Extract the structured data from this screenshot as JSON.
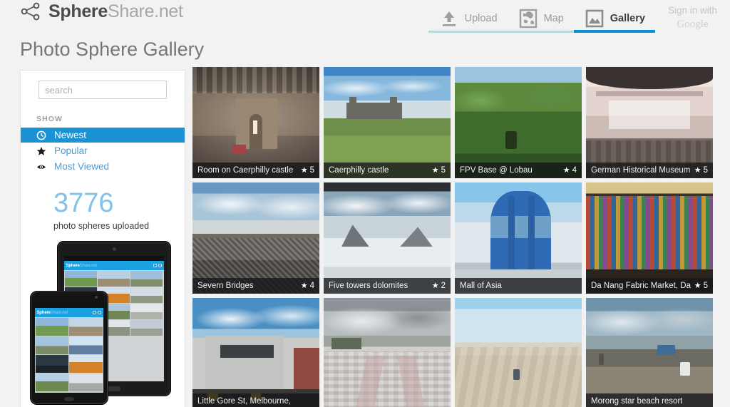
{
  "brand": {
    "name_bold": "Sphere",
    "name_light": "Share.net",
    "logo_icon": "share-nodes-icon"
  },
  "nav": {
    "items": [
      {
        "label": "Upload",
        "icon": "upload-icon",
        "active": false
      },
      {
        "label": "Map",
        "icon": "map-icon",
        "active": false
      },
      {
        "label": "Gallery",
        "icon": "image-icon",
        "active": true
      }
    ],
    "signin": {
      "line1": "Sign in with",
      "line2": "Google"
    }
  },
  "page": {
    "title": "Photo Sphere Gallery"
  },
  "sidebar": {
    "search": {
      "placeholder": "search",
      "value": ""
    },
    "show_label": "SHOW",
    "show_items": [
      {
        "label": "Newest",
        "icon": "clock-icon",
        "selected": true
      },
      {
        "label": "Popular",
        "icon": "star-icon",
        "selected": false
      },
      {
        "label": "Most Viewed",
        "icon": "eye-icon",
        "selected": false
      }
    ],
    "stat_number": "3776",
    "stat_caption": "photo spheres uploaded",
    "promo": {
      "app_name_bold": "Sphere",
      "app_name_light": "Share.net"
    }
  },
  "gallery": {
    "tiles": [
      {
        "title": "Room on Caerphilly castle",
        "rating": "5",
        "star": "★"
      },
      {
        "title": "Caerphilly castle",
        "rating": "5",
        "star": "★"
      },
      {
        "title": "FPV Base @ Lobau",
        "rating": "4",
        "star": "★"
      },
      {
        "title": "German Historical Museum",
        "rating": "5",
        "star": "★"
      },
      {
        "title": "Severn Bridges",
        "rating": "4",
        "star": "★"
      },
      {
        "title": "Five towers dolomites",
        "rating": "2",
        "star": "★"
      },
      {
        "title": "Mall of Asia",
        "rating": "",
        "star": ""
      },
      {
        "title": "Da Nang Fabric Market, Da",
        "rating": "5",
        "star": "★"
      },
      {
        "title": "Little Gore St, Melbourne,",
        "rating": "",
        "star": ""
      },
      {
        "title": "",
        "rating": "",
        "star": ""
      },
      {
        "title": "",
        "rating": "",
        "star": ""
      },
      {
        "title": "Morong star beach resort",
        "rating": "",
        "star": ""
      }
    ]
  },
  "colors": {
    "accent_blue": "#1a92d4",
    "light_blue": "#7fc2ea",
    "nav_underline": "#a8dcf5",
    "page_bg": "#f2f2f2"
  }
}
